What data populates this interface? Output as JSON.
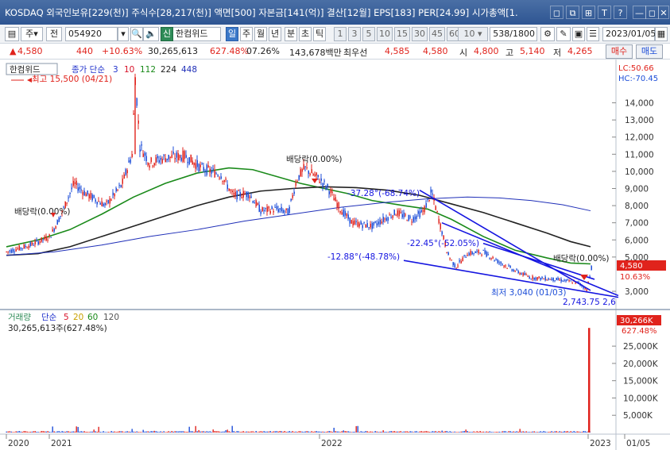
{
  "window": {
    "title": "KOSDAQ 외국인보유[229(천)] 주식수[28,217(천)] 액면[500] 자본금[141(억)] 결산[12월] EPS[183] PER[24.99] 시가총액[1.",
    "buttons": [
      "◻",
      "⧉",
      "⊞",
      "T",
      "?",
      "—",
      "◻",
      "✕"
    ]
  },
  "toolbar": {
    "market_prefix": "주",
    "market_type": "전",
    "code": "054920",
    "stock_name": "한컴위드",
    "stock_tag": "신",
    "periods": [
      "일",
      "주",
      "월",
      "년",
      "분",
      "초",
      "틱"
    ],
    "active_period": "일",
    "intervals": [
      "1",
      "3",
      "5",
      "10",
      "15",
      "30",
      "45",
      "60"
    ],
    "interval_value": "10",
    "count": "538",
    "count_total": "/1800",
    "date": "2023/01/05"
  },
  "quote": {
    "price": "4,580",
    "change": "440",
    "change_pct": "+10.63%",
    "volume": "30,265,613",
    "volume_pct": "627.48%",
    "turnover_pct": "07.26%",
    "amount": "143,678백만",
    "best_ask_label": "최우선",
    "best_ask": "4,585",
    "best_bid": "4,580",
    "open_label": "시",
    "open": "4,800",
    "high_label": "고",
    "high": "5,140",
    "low_label": "저",
    "low": "4,265",
    "buy_button": "매수",
    "sell_button": "매도"
  },
  "colors": {
    "up": "#e0231c",
    "down": "#1d4ed8",
    "ma3": "#2233cc",
    "ma10": "#8a2be2",
    "ma112": "#1a8a1a",
    "ma224": "#222222",
    "ma448": "#1f2fb8",
    "trendline": "#1515e0"
  },
  "chart_data": {
    "type": "candlestick",
    "title": "한컴위드",
    "legend": [
      {
        "name": "종가 단순",
        "color": "#2233cc"
      },
      {
        "name": "3",
        "color": "#2233cc"
      },
      {
        "name": "10",
        "color": "#d8142a"
      },
      {
        "name": "112",
        "color": "#1a8a1a"
      },
      {
        "name": "224",
        "color": "#222222"
      },
      {
        "name": "448",
        "color": "#1f2fb8"
      }
    ],
    "y_ticks": [
      "14,000",
      "13,000",
      "12,000",
      "11,000",
      "10,000",
      "9,000",
      "8,000",
      "7,000",
      "6,000",
      "5,000",
      "3,000"
    ],
    "y_range": [
      2400,
      15600
    ],
    "x_ticks": [
      "2020",
      "2021",
      "2022",
      "2023",
      "01/05"
    ],
    "lc": "LC:50.66",
    "hc": "HC:-70.45",
    "last_price_tag": "4,580",
    "last_pct_tag": "10.63%",
    "annotations": {
      "max": "최고 15,500 (04/21)",
      "min": "최저 3,040 (01/03)",
      "dividend_1": "배당락(0.00%)",
      "dividend_2": "배당락(0.00%)",
      "dividend_3": "배당락(0.00%)",
      "angle_1": "-37.28°(-68.74%)",
      "angle_2": "-22.45°(-52.05%)",
      "angle_3": "-12.88°(-48.78%)",
      "trail": "2,743.75 2,6"
    },
    "series": [
      {
        "name": "112",
        "values": [
          [
            0,
            5600
          ],
          [
            40,
            6000
          ],
          [
            80,
            6600
          ],
          [
            120,
            7500
          ],
          [
            160,
            8500
          ],
          [
            200,
            9300
          ],
          [
            240,
            9900
          ],
          [
            280,
            10200
          ],
          [
            310,
            10100
          ],
          [
            340,
            9700
          ],
          [
            370,
            9300
          ],
          [
            400,
            9000
          ],
          [
            430,
            8700
          ],
          [
            460,
            8300
          ],
          [
            500,
            8000
          ],
          [
            530,
            7800
          ],
          [
            560,
            7200
          ],
          [
            600,
            6200
          ],
          [
            640,
            5400
          ],
          [
            680,
            4950
          ],
          [
            710,
            4650
          ],
          [
            735,
            4600
          ]
        ]
      },
      {
        "name": "224",
        "values": [
          [
            0,
            5100
          ],
          [
            40,
            5200
          ],
          [
            80,
            5600
          ],
          [
            120,
            6200
          ],
          [
            160,
            6800
          ],
          [
            200,
            7400
          ],
          [
            240,
            8000
          ],
          [
            280,
            8500
          ],
          [
            320,
            8850
          ],
          [
            360,
            9000
          ],
          [
            400,
            9100
          ],
          [
            440,
            9050
          ],
          [
            480,
            8900
          ],
          [
            520,
            8600
          ],
          [
            560,
            8100
          ],
          [
            600,
            7600
          ],
          [
            640,
            7000
          ],
          [
            680,
            6400
          ],
          [
            710,
            5900
          ],
          [
            735,
            5600
          ]
        ]
      },
      {
        "name": "448",
        "values": [
          [
            0,
            5100
          ],
          [
            60,
            5300
          ],
          [
            120,
            5700
          ],
          [
            180,
            6200
          ],
          [
            240,
            6600
          ],
          [
            300,
            7100
          ],
          [
            360,
            7500
          ],
          [
            420,
            7900
          ],
          [
            480,
            8200
          ],
          [
            530,
            8400
          ],
          [
            580,
            8500
          ],
          [
            620,
            8450
          ],
          [
            660,
            8300
          ],
          [
            700,
            8050
          ],
          [
            735,
            7700
          ]
        ]
      }
    ],
    "volume": {
      "legend": [
        "거래량",
        "단순",
        "5",
        "20",
        "60",
        "120"
      ],
      "total_label": "30,265,613주(627.48%)",
      "y_ticks": [
        "25,000K",
        "20,000K",
        "15,000K",
        "10,000K",
        "5,000K"
      ],
      "last_tag": "30,266K",
      "last_pct_tag": "627.48%"
    }
  }
}
